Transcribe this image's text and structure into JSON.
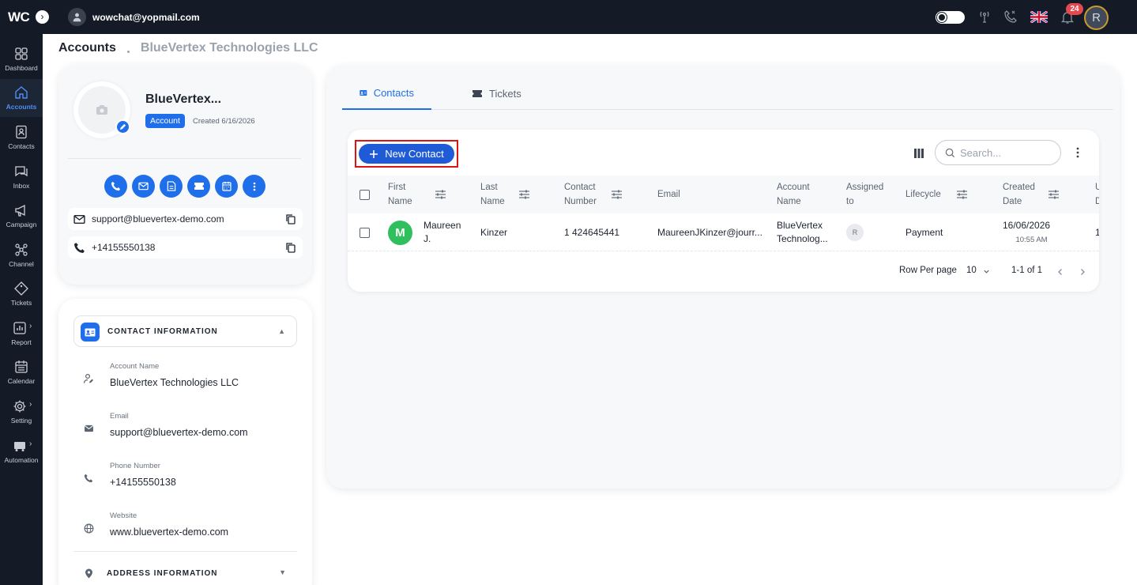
{
  "topbar": {
    "logo": "WC",
    "user_email": "wowchat@yopmail.com",
    "notification_count": "24",
    "avatar_letter": "R"
  },
  "sidebar": {
    "items": [
      {
        "label": "Dashboard",
        "icon": "grid-icon"
      },
      {
        "label": "Accounts",
        "icon": "home-icon"
      },
      {
        "label": "Contacts",
        "icon": "contact-book-icon"
      },
      {
        "label": "Inbox",
        "icon": "chat-icon"
      },
      {
        "label": "Campaign",
        "icon": "megaphone-icon"
      },
      {
        "label": "Channel",
        "icon": "network-icon"
      },
      {
        "label": "Tickets",
        "icon": "tag-icon"
      },
      {
        "label": "Report",
        "icon": "chart-icon"
      },
      {
        "label": "Calendar",
        "icon": "calendar-icon"
      },
      {
        "label": "Setting",
        "icon": "gear-icon"
      },
      {
        "label": "Automation",
        "icon": "truck-icon"
      }
    ]
  },
  "breadcrumb": {
    "title": "Accounts",
    "sub": "BlueVertex Technologies LLC"
  },
  "profile": {
    "name": "BlueVertex...",
    "badge": "Account",
    "created": "Created 6/16/2026",
    "email": "support@bluevertex-demo.com",
    "phone": "+14155550138"
  },
  "contact_info": {
    "header": "CONTACT INFORMATION",
    "fields": [
      {
        "label": "Account Name",
        "value": "BlueVertex Technologies LLC"
      },
      {
        "label": "Email",
        "value": "support@bluevertex-demo.com"
      },
      {
        "label": "Phone Number",
        "value": "+14155550138"
      },
      {
        "label": "Website",
        "value": "www.bluevertex-demo.com"
      }
    ],
    "address_header": "ADDRESS INFORMATION"
  },
  "tabs": [
    {
      "label": "Contacts"
    },
    {
      "label": "Tickets"
    }
  ],
  "toolbar": {
    "new_contact": "New Contact",
    "search_placeholder": "Search..."
  },
  "table": {
    "headers": {
      "first_name_1": "First",
      "first_name_2": "Name",
      "last_name_1": "Last",
      "last_name_2": "Name",
      "contact_number_1": "Contact",
      "contact_number_2": "Number",
      "email": "Email",
      "account_name_1": "Account",
      "account_name_2": "Name",
      "assigned_1": "Assigned",
      "assigned_2": "to",
      "lifecycle": "Lifecycle",
      "created_1": "Created",
      "created_2": "Date",
      "updated_1": "U",
      "updated_2": "D"
    },
    "row": {
      "avatar_letter": "M",
      "first_name_1": "Maureen",
      "first_name_2": "J.",
      "last_name": "Kinzer",
      "contact_number": "1 424645441",
      "email": "MaureenJKinzer@jourr...",
      "account_name_1": "BlueVertex",
      "account_name_2": "Technolog...",
      "assigned_letter": "R",
      "lifecycle": "Payment",
      "created_date": "16/06/2026",
      "created_time": "10:55 AM",
      "updated_partial": "1"
    }
  },
  "pagination": {
    "rows_label": "Row Per page",
    "rows_value": "10",
    "range": "1-1 of 1"
  },
  "colors": {
    "accent": "#1f6feb",
    "topbar_bg": "#141b26",
    "highlight_border": "#d81414",
    "row_avatar": "#2fbf5c",
    "badge_red": "#e5484d"
  }
}
